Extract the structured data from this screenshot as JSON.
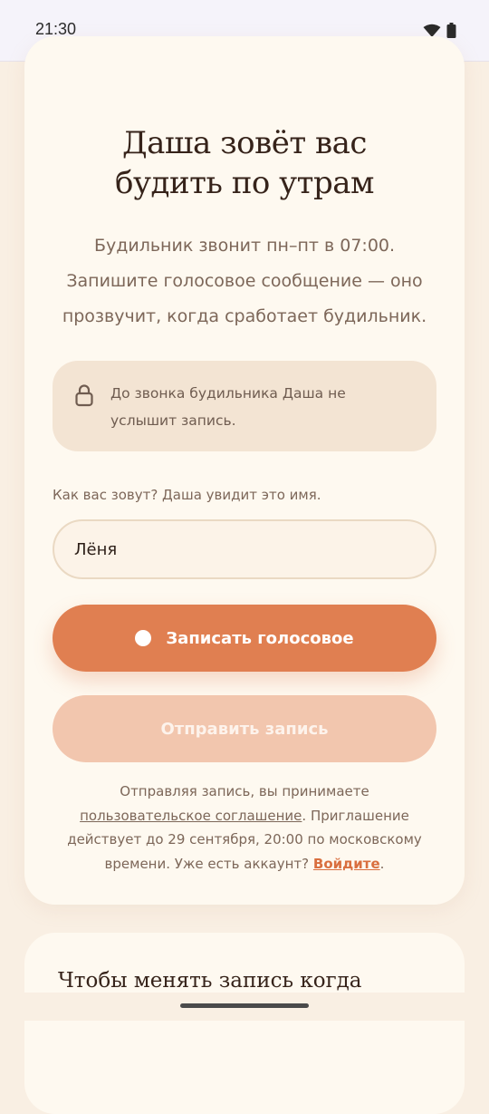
{
  "status_bar": {
    "time": "21:30",
    "icons": [
      "wifi-icon",
      "battery-icon"
    ]
  },
  "invite_card": {
    "title_line1": "Даша зовёт вас",
    "title_line2": "будить по утрам",
    "description": "Будильник звонит пн–пт в 07:00. Запишите голосовое сообщение — оно прозвучит, когда сработает будильник.",
    "privacy_notice": "До звонка будильника Даша не услышит запись.",
    "name_label": "Как вас зовут? Даша увидит это имя.",
    "name_value": "Лёня",
    "record_button": "Записать голосовое",
    "send_button": "Отправить запись",
    "legal_prefix": "Отправляя запись, вы принимаете",
    "terms_link": "пользовательское соглашение",
    "legal_middle": ". Приглашение действует до 29 сентября, 20:00 по московскому времени. Уже есть аккаунт?",
    "login_link": "Войдите",
    "legal_suffix": "."
  },
  "second_card": {
    "title": "Чтобы менять запись когда"
  },
  "colors": {
    "background": "#f9efe3",
    "card": "#fef9f0",
    "accent": "#e07f51",
    "accent_disabled": "#f2c6ae",
    "notice_bg": "#f3e4d3",
    "heading": "#36231a",
    "body_text": "#7d6759",
    "link_accent": "#d96f3f"
  }
}
